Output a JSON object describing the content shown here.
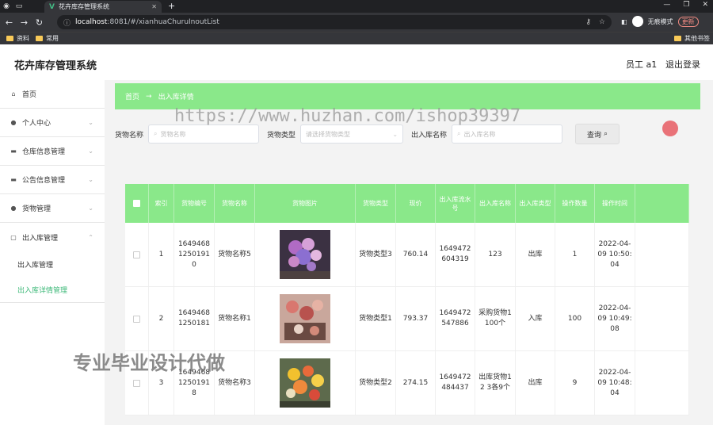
{
  "browser": {
    "tab_title": "花卉库存管理系统",
    "url_host": "localhost",
    "url_rest": ":8081/#/xianhuaChuruInoutList",
    "profile_label": "无痕模式",
    "update_label": "更新",
    "bookmarks": [
      "资料",
      "常用"
    ],
    "bookmark_right": "其他书签"
  },
  "app": {
    "title": "花卉库存管理系统",
    "user": "员工 a1",
    "logout": "退出登录"
  },
  "sidebar": {
    "items": [
      {
        "label": "首页",
        "icon": "home-icon"
      },
      {
        "label": "个人中心",
        "icon": "user-icon"
      },
      {
        "label": "仓库信息管理",
        "icon": "monitor-icon"
      },
      {
        "label": "公告信息管理",
        "icon": "monitor-icon"
      },
      {
        "label": "货物管理",
        "icon": "user-icon"
      },
      {
        "label": "出入库管理",
        "icon": "box-icon"
      }
    ],
    "sub_items": [
      "出入库管理",
      "出入库详情管理"
    ]
  },
  "breadcrumb": {
    "home": "首页",
    "arrow": "→",
    "current": "出入库详情"
  },
  "search": {
    "goods_name_label": "货物名称",
    "goods_name_placeholder": "货物名称",
    "goods_type_label": "货物类型",
    "goods_type_placeholder": "请选择货物类型",
    "io_name_label": "出入库名称",
    "io_name_placeholder": "出入库名称",
    "query_button": "查询"
  },
  "watermark": "https://www.huzhan.com/ishop39397",
  "watermark2": "专业毕业设计代做",
  "table": {
    "headers": [
      "索引",
      "货物编号",
      "货物名称",
      "货物图片",
      "货物类型",
      "现价",
      "出入库流水号",
      "出入库名称",
      "出入库类型",
      "操作数量",
      "操作时间"
    ],
    "rows": [
      {
        "index": "1",
        "goods_no": "16494681250191 0",
        "goods_name": "货物名称5",
        "goods_type": "货物类型3",
        "price": "760.14",
        "serial": "1649472604319",
        "io_name": "123",
        "io_type": "出库",
        "qty": "1",
        "time": "2022-04-09 10:50:04"
      },
      {
        "index": "2",
        "goods_no": "1649468 1250181",
        "goods_name": "货物名称1",
        "goods_type": "货物类型1",
        "price": "793.37",
        "serial": "1649472547886",
        "io_name": "采购货物1 100个",
        "io_type": "入库",
        "qty": "100",
        "time": "2022-04-09 10:49:08"
      },
      {
        "index": "3",
        "goods_no": "16494681250191 8",
        "goods_name": "货物名称3",
        "goods_type": "货物类型2",
        "price": "274.15",
        "serial": "1649472484437",
        "io_name": "出库货物1 2 3各9个",
        "io_type": "出库",
        "qty": "9",
        "time": "2022-04-09 10:48:04"
      }
    ]
  },
  "colors": {
    "accent_green": "#8ae88a",
    "active_menu": "#3cb878"
  }
}
